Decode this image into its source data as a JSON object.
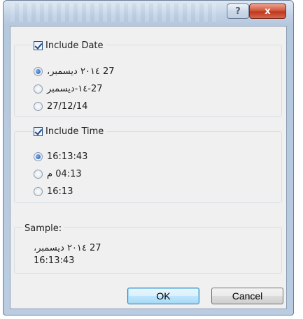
{
  "titlebar": {
    "help_label": "?",
    "close_label": "x"
  },
  "date_group": {
    "checkbox_label": "Include Date",
    "checked": true,
    "options": [
      {
        "label": "27 ٢٠١٤ ديسمبر،",
        "selected": true
      },
      {
        "label": "27-١٤-ديسمبر",
        "selected": false
      },
      {
        "label": "27/12/14",
        "selected": false
      }
    ]
  },
  "time_group": {
    "checkbox_label": "Include Time",
    "checked": true,
    "options": [
      {
        "label": "16:13:43",
        "selected": true
      },
      {
        "label": "04:13 م",
        "selected": false
      },
      {
        "label": "16:13",
        "selected": false
      }
    ]
  },
  "sample": {
    "label": "Sample:",
    "line1": "27 ٢٠١٤ ديسمبر،",
    "line2": "16:13:43"
  },
  "buttons": {
    "ok_label": "OK",
    "cancel_label": "Cancel"
  }
}
